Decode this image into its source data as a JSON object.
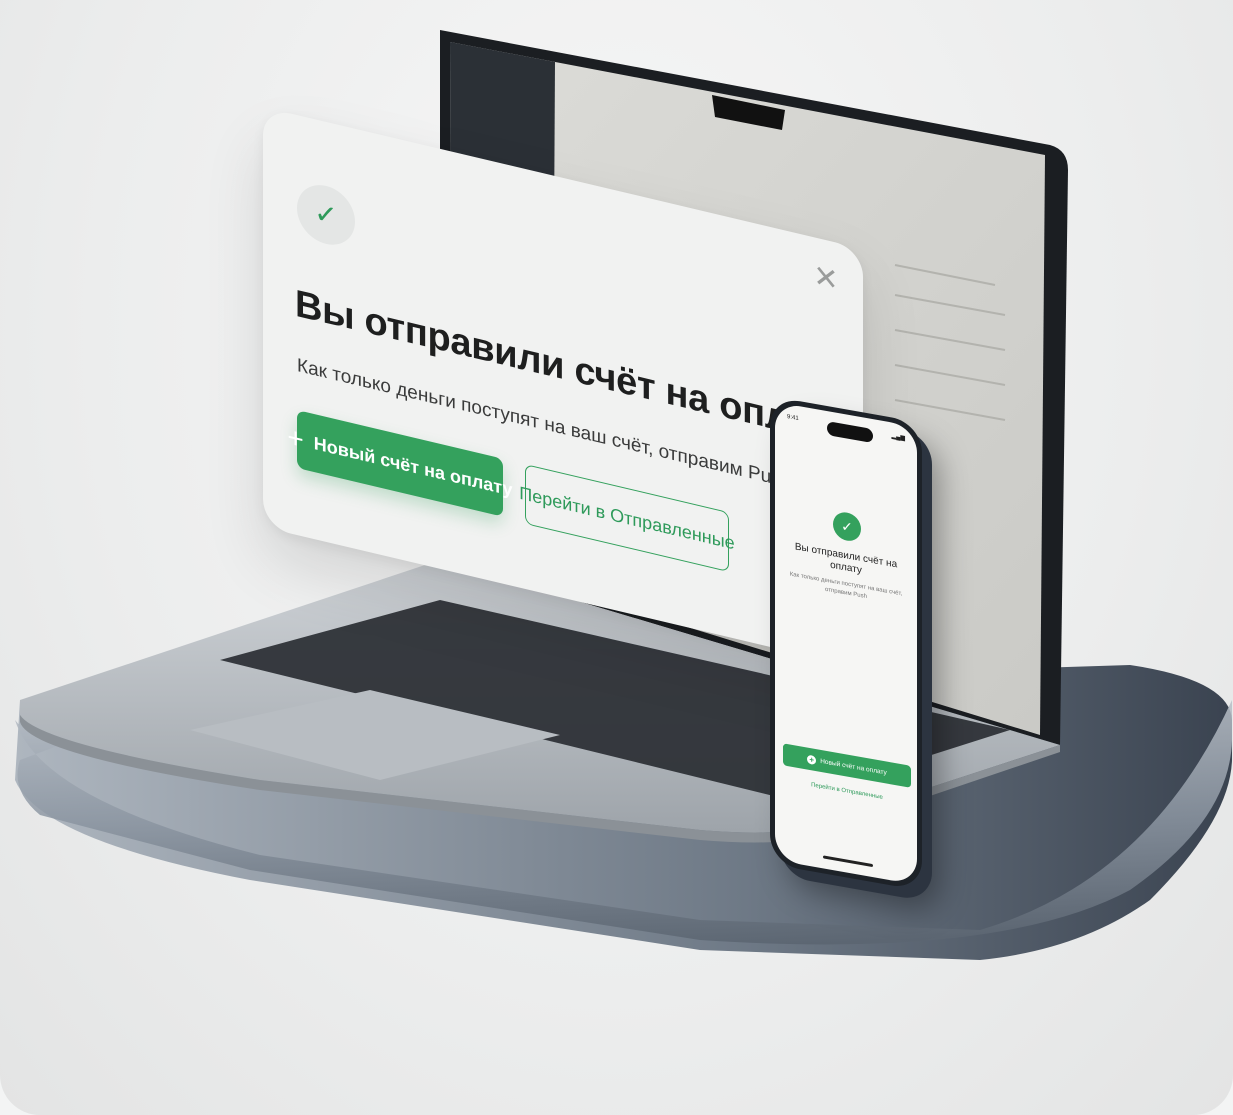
{
  "modal": {
    "check_icon": "checkmark-icon",
    "close_icon": "close-icon",
    "title": "Вы отправили счёт на оплату",
    "subtitle": "Как только деньги поступят на ваш счёт, отправим Push",
    "primary_button": "Новый счёт на оплату",
    "secondary_button": "Перейти в Отправленные"
  },
  "phone": {
    "time": "9:41",
    "title": "Вы отправили счёт на оплату",
    "subtitle": "Как только деньги поступят на ваш счёт, отправим Push",
    "primary_button": "Новый счёт на оплату",
    "secondary_link": "Перейти в Отправленные"
  },
  "colors": {
    "accent": "#34a15d",
    "modal_bg": "#f1f2f1",
    "text": "#1e1f1f"
  }
}
